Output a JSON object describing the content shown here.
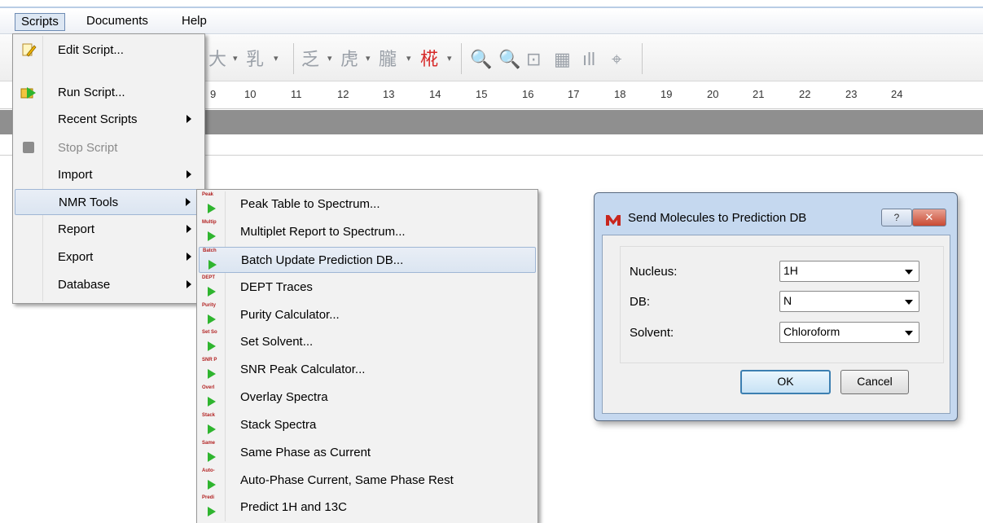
{
  "menubar": {
    "items": [
      "Scripts",
      "Documents",
      "Help"
    ]
  },
  "ruler": {
    "ticks": [
      "9",
      "10",
      "11",
      "12",
      "13",
      "14",
      "15",
      "16",
      "17",
      "18",
      "19",
      "20",
      "21",
      "22",
      "23",
      "24"
    ]
  },
  "scripts_menu": {
    "items": [
      {
        "label": "Edit Script...",
        "icon": "edit-script-icon"
      },
      {
        "label": "Run Script...",
        "icon": "run-script-icon"
      },
      {
        "label": "Recent Scripts",
        "submenu": true
      },
      {
        "label": "Stop Script",
        "icon": "stop-icon",
        "disabled": true
      },
      {
        "label": "Import",
        "submenu": true
      },
      {
        "label": "NMR Tools",
        "submenu": true,
        "highlighted": true
      },
      {
        "label": "Report",
        "submenu": true
      },
      {
        "label": "Export",
        "submenu": true
      },
      {
        "label": "Database",
        "submenu": true
      }
    ]
  },
  "nmr_tools_menu": {
    "items": [
      {
        "label": "Peak Table to Spectrum...",
        "icon_caption": "Peak"
      },
      {
        "label": "Multiplet Report to Spectrum...",
        "icon_caption": "Multip"
      },
      {
        "label": "Batch Update Prediction DB...",
        "icon_caption": "Batch",
        "highlighted": true
      },
      {
        "label": "DEPT Traces",
        "icon_caption": "DEPT"
      },
      {
        "label": "Purity Calculator...",
        "icon_caption": "Purity"
      },
      {
        "label": "Set Solvent...",
        "icon_caption": "Set So"
      },
      {
        "label": "SNR Peak Calculator...",
        "icon_caption": "SNR P"
      },
      {
        "label": "Overlay Spectra",
        "icon_caption": "Overl"
      },
      {
        "label": "Stack Spectra",
        "icon_caption": "Stack"
      },
      {
        "label": "Same Phase as Current",
        "icon_caption": "Same"
      },
      {
        "label": "Auto-Phase Current, Same Phase Rest",
        "icon_caption": "Auto-"
      },
      {
        "label": "Predict 1H and 13C",
        "icon_caption": "Predi"
      }
    ]
  },
  "dialog": {
    "title": "Send Molecules to Prediction DB",
    "help_label": "?",
    "close_label": "✕",
    "fields": [
      {
        "label": "Nucleus:",
        "value": "1H"
      },
      {
        "label": "DB:",
        "value": "N"
      },
      {
        "label": "Solvent:",
        "value": "Chloroform"
      }
    ],
    "ok_label": "OK",
    "cancel_label": "Cancel"
  },
  "colors": {
    "menu_bg": "#f2f2f2",
    "highlight": "#dbe5f1",
    "dialog_frame": "#c5d8ef",
    "close_button": "#c94a33",
    "play_icon": "#2fb52f",
    "icon_caption": "#b22222"
  }
}
